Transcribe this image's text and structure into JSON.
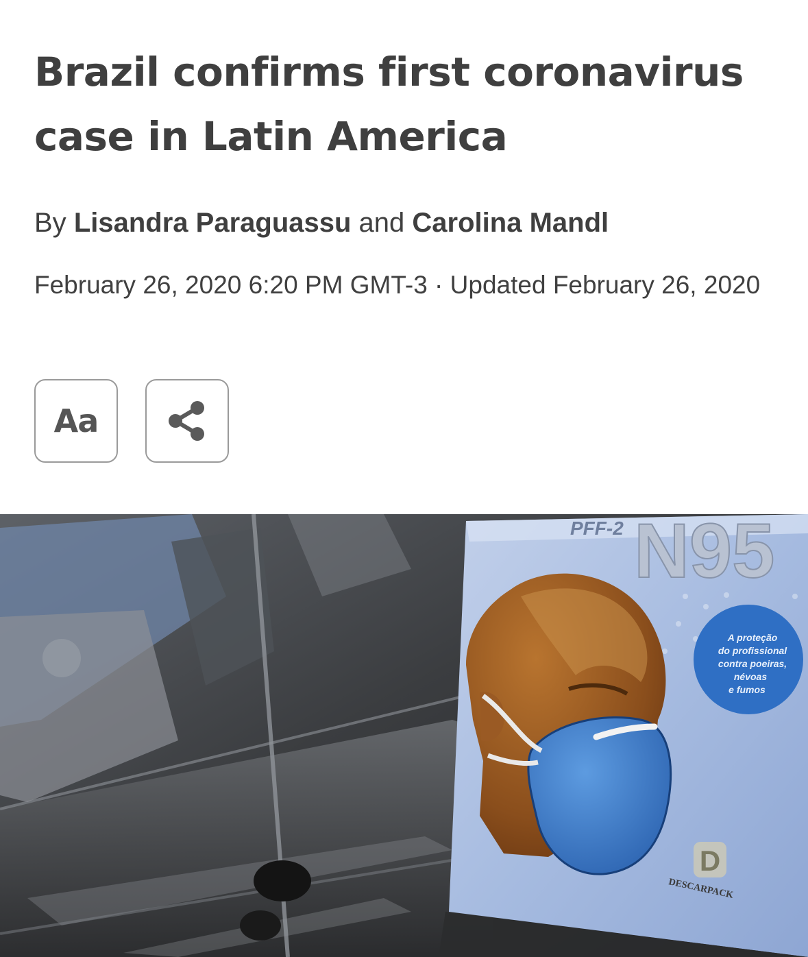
{
  "article": {
    "headline": "Brazil confirms first coronavirus case in Latin America",
    "byline": {
      "prefix": "By",
      "author1": "Lisandra Paraguassu",
      "conjunction": "and",
      "author2": "Carolina Mandl"
    },
    "dateline": "February 26, 2020 6:20 PM GMT-3 · Updated February 26, 2020"
  },
  "toolbar": {
    "font_label": "Aa",
    "font_icon": "text-size-icon",
    "share_icon": "share-icon"
  },
  "photo": {
    "mask_box": {
      "standard": "PFF-2",
      "rating": "N95",
      "tagline": [
        "A proteção",
        "do profissional",
        "contra poeiras,",
        "névoas",
        "e fumos"
      ],
      "brand": "DESCARPACK",
      "brand_initial": "D"
    }
  },
  "colors": {
    "headline": "#3f3f3f",
    "body_text": "#404040",
    "button_border": "#9a9a9a",
    "mask_blue": "#3f7fc9",
    "box_blue": "#9fb6df",
    "badge_blue": "#2f6fc4"
  }
}
